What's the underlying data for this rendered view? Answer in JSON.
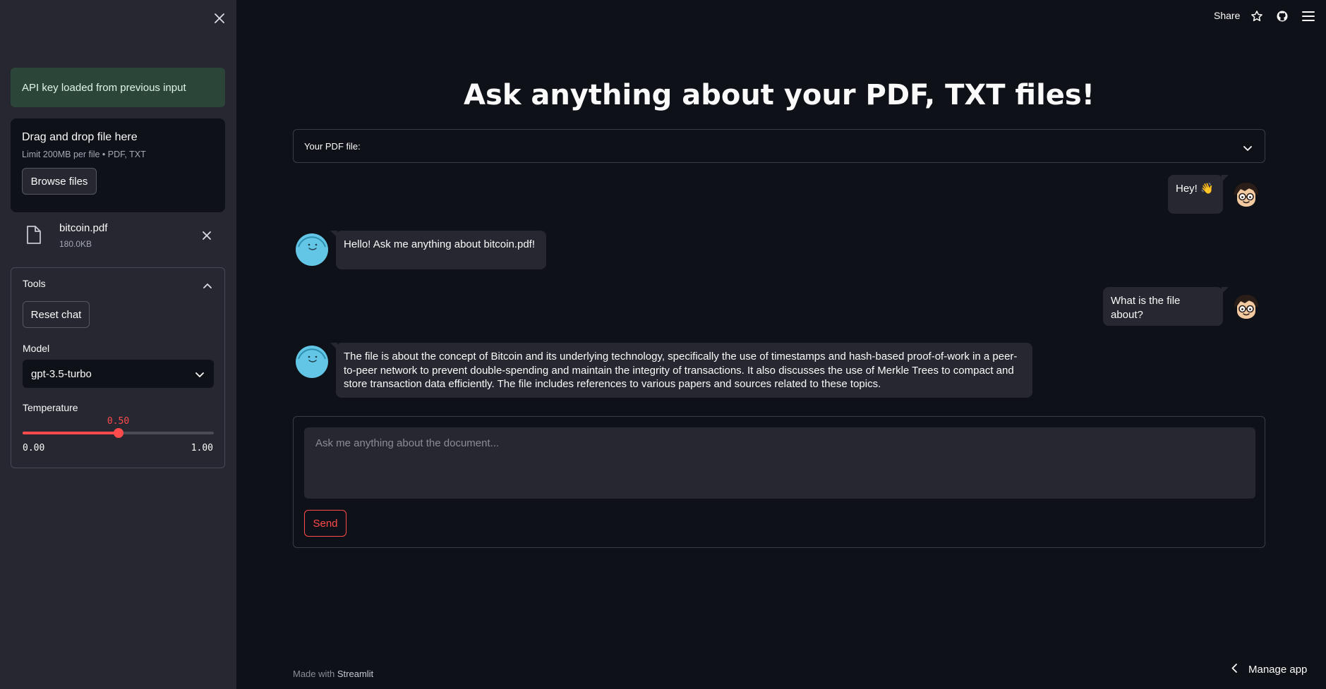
{
  "sidebar": {
    "success_message": "API key loaded from previous input",
    "uploader": {
      "title": "Drag and drop file here",
      "limit": "Limit 200MB per file • PDF, TXT",
      "browse_label": "Browse files"
    },
    "file": {
      "name": "bitcoin.pdf",
      "size": "180.0KB"
    },
    "tools": {
      "header": "Tools",
      "reset_label": "Reset chat",
      "model_label": "Model",
      "model_value": "gpt-3.5-turbo",
      "temperature_label": "Temperature",
      "temperature_value": "0.50",
      "temperature_fraction": 0.5,
      "temperature_min": "0.00",
      "temperature_max": "1.00"
    }
  },
  "header": {
    "share_label": "Share"
  },
  "main": {
    "title": "Ask anything about your PDF, TXT files!",
    "expander_label": "Your PDF file:",
    "messages": [
      {
        "role": "user",
        "text": "Hey! 👋"
      },
      {
        "role": "assistant",
        "text": "Hello! Ask me anything about bitcoin.pdf!"
      },
      {
        "role": "user",
        "text": "What is the file about?"
      },
      {
        "role": "assistant",
        "text": "The file is about the concept of Bitcoin and its underlying technology, specifically the use of timestamps and hash-based proof-of-work in a peer-to-peer network to prevent double-spending and maintain the integrity of transactions. It also discusses the use of Merkle Trees to compact and store transaction data efficiently. The file includes references to various papers and sources related to these topics."
      }
    ],
    "input_placeholder": "Ask me anything about the document...",
    "send_label": "Send"
  },
  "footer": {
    "made_with": "Made with",
    "brand": "Streamlit",
    "manage_app": "Manage app"
  },
  "colors": {
    "accent": "#ff4b4b",
    "background": "#0e1117",
    "sidebar": "#262730",
    "success_bg": "#2b4538"
  }
}
